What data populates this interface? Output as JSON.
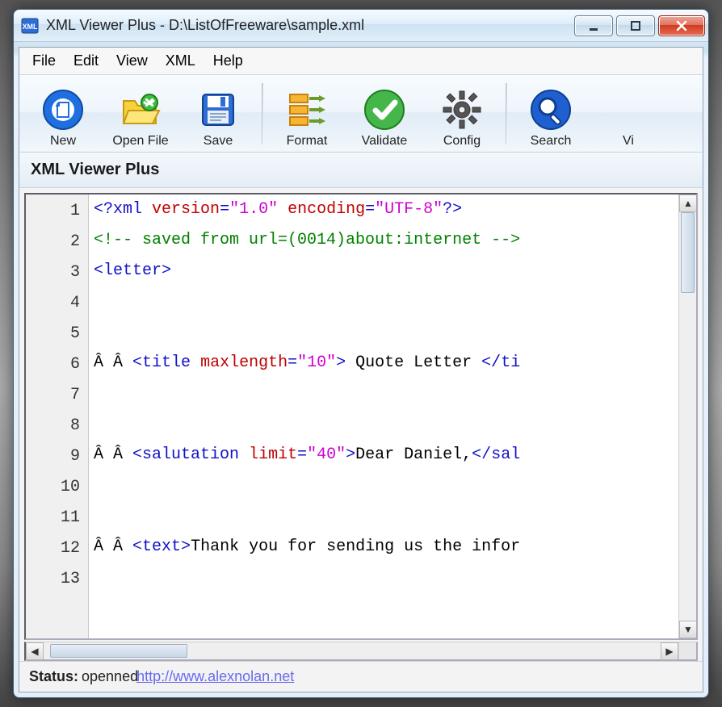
{
  "window": {
    "title": "XML Viewer Plus - D:\\ListOfFreeware\\sample.xml"
  },
  "menubar": {
    "items": [
      "File",
      "Edit",
      "View",
      "XML",
      "Help"
    ]
  },
  "toolbar": {
    "buttons": [
      {
        "id": "new",
        "label": "New",
        "icon": "new"
      },
      {
        "id": "openfile",
        "label": "Open File",
        "icon": "open"
      },
      {
        "id": "save",
        "label": "Save",
        "icon": "save"
      },
      {
        "id": "format",
        "label": "Format",
        "icon": "format"
      },
      {
        "id": "validate",
        "label": "Validate",
        "icon": "validate"
      },
      {
        "id": "config",
        "label": "Config",
        "icon": "config"
      },
      {
        "id": "search",
        "label": "Search",
        "icon": "search"
      },
      {
        "id": "view",
        "label": "Vi",
        "icon": "view-partial"
      }
    ],
    "separator_after": [
      2,
      5
    ]
  },
  "sub_header": "XML Viewer Plus",
  "editor": {
    "line_numbers": [
      1,
      2,
      3,
      4,
      5,
      6,
      7,
      8,
      9,
      10,
      11,
      12,
      13
    ],
    "lines": [
      {
        "n": 1,
        "tokens": [
          {
            "t": "<?",
            "c": "pi"
          },
          {
            "t": "xml",
            "c": "pi"
          },
          {
            "t": " ",
            "c": "text-plain"
          },
          {
            "t": "version",
            "c": "attr"
          },
          {
            "t": "=",
            "c": "pi"
          },
          {
            "t": "\"1.0\"",
            "c": "str"
          },
          {
            "t": " ",
            "c": "text-plain"
          },
          {
            "t": "encoding",
            "c": "attr"
          },
          {
            "t": "=",
            "c": "pi"
          },
          {
            "t": "\"UTF-8\"",
            "c": "str"
          },
          {
            "t": "?>",
            "c": "pi"
          }
        ]
      },
      {
        "n": 2,
        "tokens": [
          {
            "t": "<!-- saved from url=(0014)about:internet -->",
            "c": "comment"
          }
        ]
      },
      {
        "n": 3,
        "tokens": [
          {
            "t": "<",
            "c": "tag"
          },
          {
            "t": "letter",
            "c": "tag"
          },
          {
            "t": ">",
            "c": "tag"
          }
        ]
      },
      {
        "n": 4,
        "tokens": []
      },
      {
        "n": 5,
        "tokens": []
      },
      {
        "n": 6,
        "tokens": [
          {
            "t": "Â Â ",
            "c": "text-plain"
          },
          {
            "t": "<",
            "c": "tag"
          },
          {
            "t": "title",
            "c": "tag"
          },
          {
            "t": " ",
            "c": "text-plain"
          },
          {
            "t": "maxlength",
            "c": "attr"
          },
          {
            "t": "=",
            "c": "tag"
          },
          {
            "t": "\"10\"",
            "c": "str"
          },
          {
            "t": ">",
            "c": "tag"
          },
          {
            "t": " Quote Letter ",
            "c": "text-plain"
          },
          {
            "t": "</",
            "c": "tag"
          },
          {
            "t": "ti",
            "c": "tag"
          }
        ]
      },
      {
        "n": 7,
        "tokens": []
      },
      {
        "n": 8,
        "tokens": []
      },
      {
        "n": 9,
        "tokens": [
          {
            "t": "Â Â ",
            "c": "text-plain"
          },
          {
            "t": "<",
            "c": "tag"
          },
          {
            "t": "salutation",
            "c": "tag"
          },
          {
            "t": " ",
            "c": "text-plain"
          },
          {
            "t": "limit",
            "c": "attr"
          },
          {
            "t": "=",
            "c": "tag"
          },
          {
            "t": "\"40\"",
            "c": "str"
          },
          {
            "t": ">",
            "c": "tag"
          },
          {
            "t": "Dear Daniel,",
            "c": "text-plain"
          },
          {
            "t": "</",
            "c": "tag"
          },
          {
            "t": "sal",
            "c": "tag"
          }
        ]
      },
      {
        "n": 10,
        "tokens": []
      },
      {
        "n": 11,
        "tokens": []
      },
      {
        "n": 12,
        "tokens": [
          {
            "t": "Â Â ",
            "c": "text-plain"
          },
          {
            "t": "<",
            "c": "tag"
          },
          {
            "t": "text",
            "c": "tag"
          },
          {
            "t": ">",
            "c": "tag"
          },
          {
            "t": "Thank you for sending us the infor",
            "c": "text-plain"
          }
        ]
      },
      {
        "n": 13,
        "tokens": []
      }
    ]
  },
  "status": {
    "label": "Status:",
    "value": "openned",
    "link_text": "http://www.alexnolan.net"
  }
}
